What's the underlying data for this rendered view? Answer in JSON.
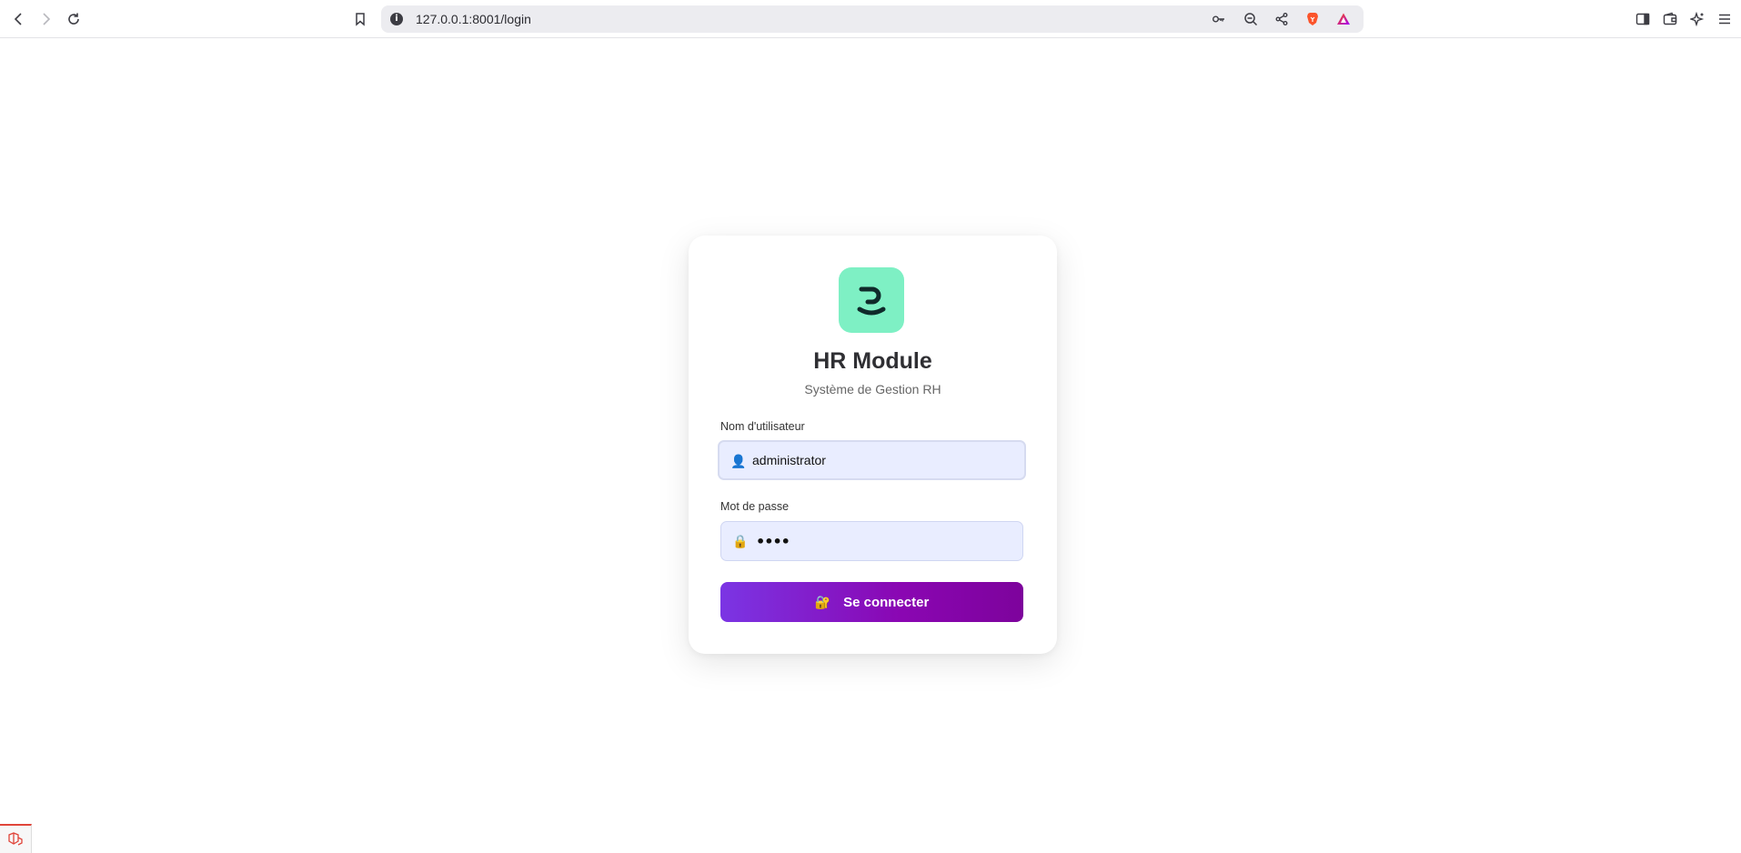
{
  "browser": {
    "url": "127.0.0.1:8001/login",
    "icons": {
      "back": "back-arrow-icon",
      "forward": "forward-arrow-icon",
      "reload": "reload-icon",
      "bookmark": "bookmark-icon",
      "site_info": "info-icon",
      "key": "key-icon",
      "zoom": "zoom-out-icon",
      "share": "share-icon",
      "brave": "brave-lion-icon",
      "rewards": "brave-rewards-icon",
      "sidebar": "sidebar-icon",
      "wallet": "wallet-icon",
      "leo": "leo-ai-icon",
      "menu": "hamburger-menu-icon"
    }
  },
  "login": {
    "logo": "app-logo",
    "title": "HR Module",
    "subtitle": "Système de Gestion RH",
    "username_label": "Nom d'utilisateur",
    "username_value": "administrator",
    "username_icon": "👤",
    "password_label": "Mot de passe",
    "password_value": "••••",
    "password_icon": "🔒",
    "submit_icon": "🔐",
    "submit_label": "Se connecter"
  },
  "colors": {
    "logo_bg": "#7ef0c4",
    "input_bg": "#e9edff",
    "button_gradient_start": "#7b35e4",
    "button_gradient_end": "#7d039c"
  }
}
